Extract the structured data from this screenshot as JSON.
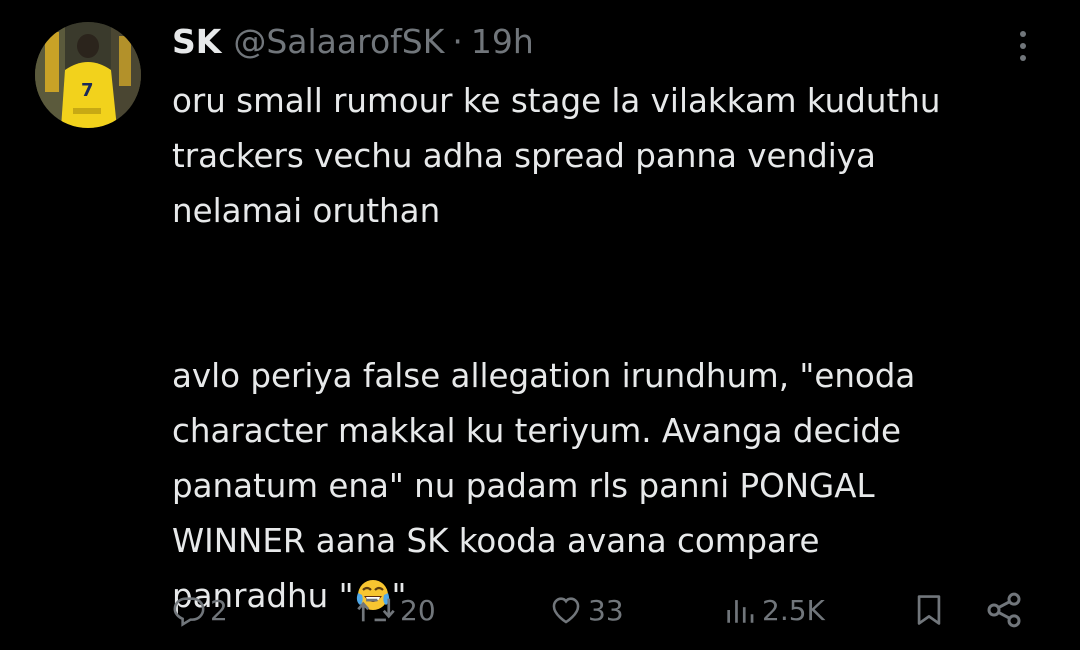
{
  "tweet": {
    "name": "SK",
    "handle": "@SalaarofSK",
    "separator": "·",
    "time": "19h",
    "avatar_icon": "avatar-image",
    "paragraph1_line1": "oru small rumour ke stage la vilakkam kuduthu",
    "paragraph1_line2": "trackers vechu adha spread panna vendiya",
    "paragraph1_line3": "nelamai oruthan",
    "paragraph2_line1": "avlo periya false allegation irundhum, \"enoda",
    "paragraph2_line2": "character makkal ku teriyum. Avanga decide",
    "paragraph2_line3": "panatum ena\" nu padam rls panni PONGAL",
    "paragraph2_line4": "WINNER aana SK kooda avana compare",
    "paragraph2_line5_before": "panradhu \"",
    "paragraph2_line5_after": "\"",
    "emoji_icon": "face-with-tears-of-joy-icon"
  },
  "actions": {
    "replies": "2",
    "retweets": "20",
    "likes": "33",
    "views": "2.5K"
  },
  "colors": {
    "background": "#000000",
    "text": "#e7e9ea",
    "muted": "#71767b"
  }
}
